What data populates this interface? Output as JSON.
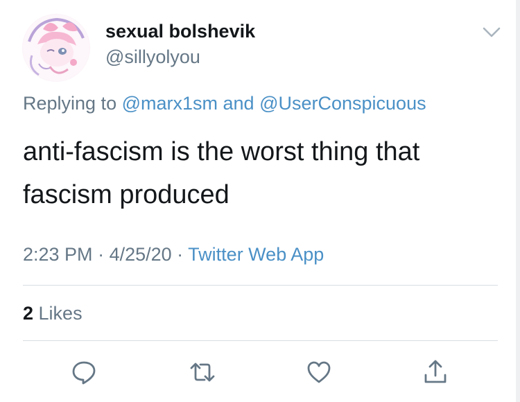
{
  "user": {
    "display_name": "sexual bolshevik",
    "handle": "@sillyolyou"
  },
  "reply": {
    "prefix": "Replying to ",
    "mention_1": "@marx1sm",
    "joiner": " and ",
    "mention_2": "@UserConspicuous"
  },
  "tweet": {
    "line_1": "anti-fascism is the worst thing that",
    "line_2": "fascism produced"
  },
  "meta": {
    "time": "2:23 PM",
    "sep_1": " · ",
    "date": "4/25/20",
    "sep_2": " · ",
    "source": "Twitter Web App"
  },
  "stats": {
    "likes_count": "2",
    "likes_label": " Likes"
  },
  "actions": [
    {
      "icon": "reply-icon"
    },
    {
      "icon": "retweet-icon"
    },
    {
      "icon": "like-icon"
    },
    {
      "icon": "share-icon"
    }
  ],
  "colors": {
    "text": "#14171a",
    "secondary": "#657786",
    "link": "#4a90c6",
    "divider": "#d8dde2"
  }
}
